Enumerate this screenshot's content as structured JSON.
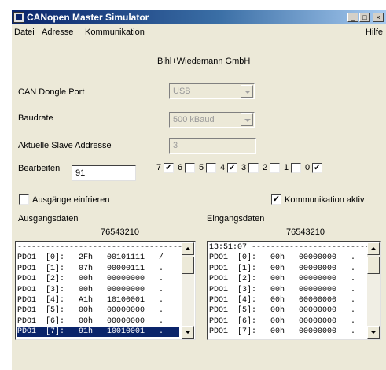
{
  "window": {
    "title": "CANopen Master Simulator",
    "buttons": {
      "minimize": "_",
      "maximize": "□",
      "close": "×"
    }
  },
  "menu": {
    "datei": "Datei",
    "adresse": "Adresse",
    "kommunikation": "Kommunikation",
    "hilfe": "Hilfe"
  },
  "company": "Bihl+Wiedemann GmbH",
  "dongle": {
    "label": "CAN Dongle Port",
    "value": "USB"
  },
  "baud": {
    "label": "Baudrate",
    "value": "500 kBaud"
  },
  "slave": {
    "label": "Aktuelle Slave Addresse",
    "value": "3"
  },
  "edit": {
    "label": "Bearbeiten",
    "value": "91"
  },
  "bits": [
    {
      "label": "7",
      "checked": true
    },
    {
      "label": "6",
      "checked": false
    },
    {
      "label": "5",
      "checked": false
    },
    {
      "label": "4",
      "checked": true
    },
    {
      "label": "3",
      "checked": false
    },
    {
      "label": "2",
      "checked": false
    },
    {
      "label": "1",
      "checked": false
    },
    {
      "label": "0",
      "checked": true
    }
  ],
  "freeze": {
    "label": "Ausgänge einfrieren",
    "checked": false
  },
  "comm": {
    "label": "Kommunikation aktiv",
    "checked": true
  },
  "outputs": {
    "title": "Ausgangsdaten",
    "bit_header": "76543210",
    "rows": [
      "-------------------------------------",
      "PDO1  [0]:   2Fh   00101111   /",
      "PDO1  [1]:   07h   00000111   .",
      "PDO1  [2]:   00h   00000000   .",
      "PDO1  [3]:   00h   00000000   .",
      "PDO1  [4]:   A1h   10100001   .",
      "PDO1  [5]:   00h   00000000   .",
      "PDO1  [6]:   00h   00000000   .",
      "PDO1  [7]:   91h   10010001   ."
    ],
    "selected_row": 8
  },
  "inputs": {
    "title": "Eingangsdaten",
    "bit_header": "76543210",
    "rows": [
      "13:51:07 ---------------------------",
      "PDO1  [0]:   00h   00000000   .",
      "PDO1  [1]:   00h   00000000   .",
      "PDO1  [2]:   00h   00000000   .",
      "PDO1  [3]:   00h   00000000   .",
      "PDO1  [4]:   00h   00000000   .",
      "PDO1  [5]:   00h   00000000   .",
      "PDO1  [6]:   00h   00000000   .",
      "PDO1  [7]:   00h   00000000   ."
    ]
  }
}
